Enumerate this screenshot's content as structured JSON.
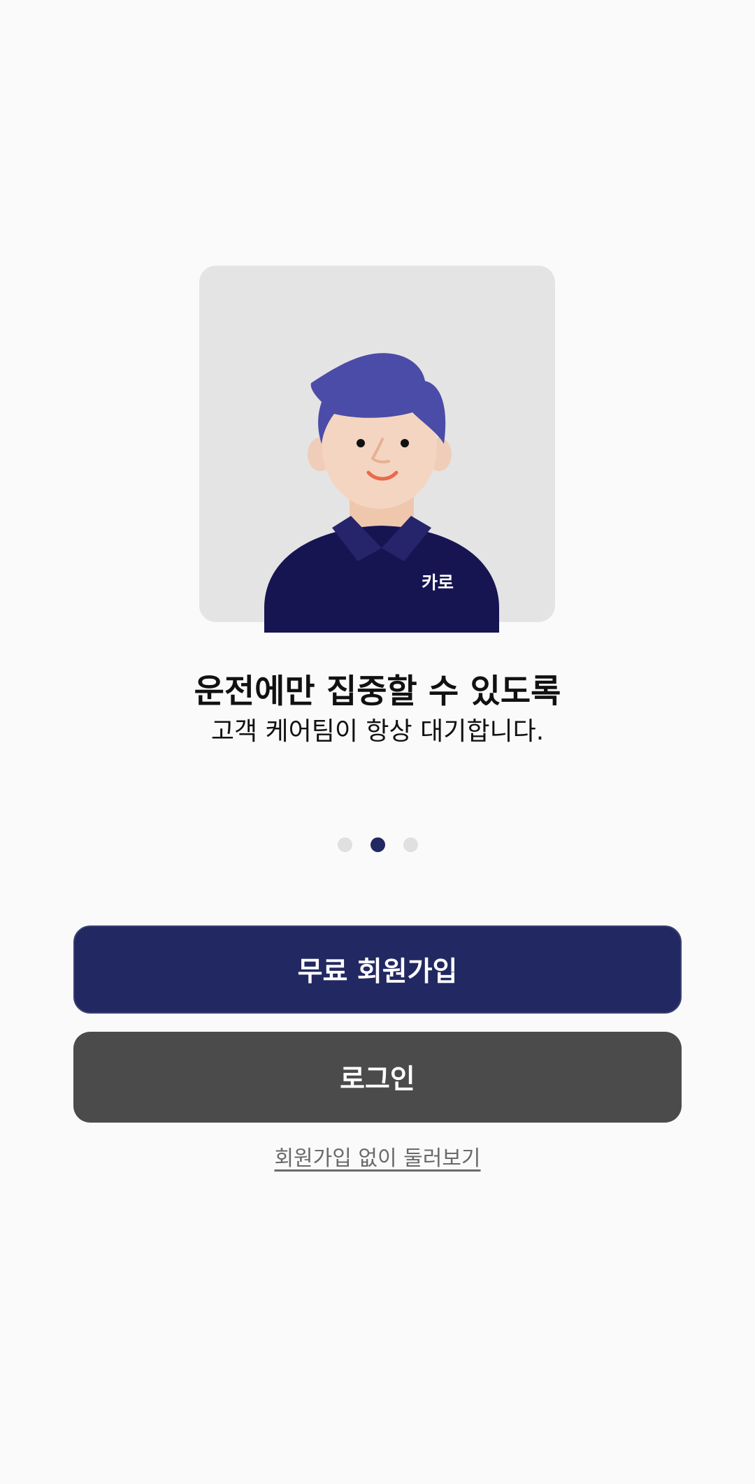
{
  "onboarding": {
    "title": "운전에만 집중할 수 있도록",
    "subtitle": "고객 케어팀이 항상 대기합니다.",
    "illustration": {
      "shirt_logo_text": "카로",
      "colors": {
        "card_background": "#e4e4e4",
        "hair": "#4b4ca8",
        "skin": "#f4d5c2",
        "shirt": "#171452",
        "collar": "#26246b"
      }
    },
    "pager": {
      "total_pages": 3,
      "active_page": 2
    }
  },
  "actions": {
    "signup_label": "무료 회원가입",
    "login_label": "로그인",
    "browse_label": "회원가입 없이 둘러보기"
  },
  "colors": {
    "primary": "#222862",
    "secondary_button": "#4b4b4b",
    "background": "#fafafa",
    "pager_inactive": "#e0e0e0"
  }
}
